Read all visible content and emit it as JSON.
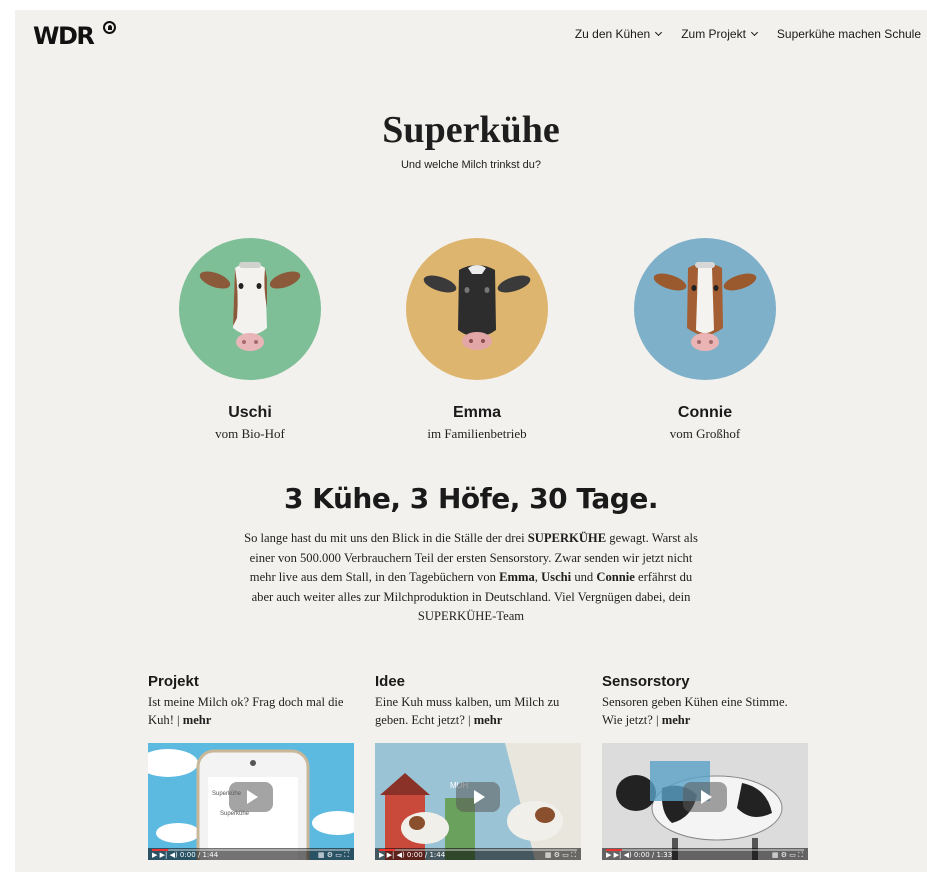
{
  "header": {
    "logo": "WDR",
    "nav": [
      {
        "label": "Zu den Kühen",
        "dropdown": true
      },
      {
        "label": "Zum Projekt",
        "dropdown": true
      },
      {
        "label": "Superkühe machen Schule",
        "dropdown": false
      }
    ]
  },
  "hero": {
    "title": "Superkühe",
    "subtitle": "Und welche Milch trinkst du?"
  },
  "cows": [
    {
      "name": "Uschi",
      "desc": "vom Bio-Hof",
      "color": "#7fbf98"
    },
    {
      "name": "Emma",
      "desc": "im Familienbetrieb",
      "color": "#ddb56f"
    },
    {
      "name": "Connie",
      "desc": "vom Großhof",
      "color": "#7fb0c9"
    }
  ],
  "intro": {
    "title": "3 Kühe, 3 Höfe, 30 Tage.",
    "p1": "So lange hast du mit uns den Blick in die Ställe der drei ",
    "b1": "SUPERKÜHE",
    "p2": " gewagt. Warst als einer von 500.000 Verbrauchern Teil der ersten Sensorstory. Zwar senden wir jetzt nicht mehr live aus dem Stall, in den Tagebüchern von ",
    "b2": "Emma",
    "p3": ", ",
    "b3": "Uschi",
    "p4": " und ",
    "b4": "Connie",
    "p5": " erfährst du aber auch weiter alles zur Milchproduktion in Deutschland. Viel Vergnügen dabei, dein SUPERKÜHE-Team"
  },
  "teasers": [
    {
      "title": "Projekt",
      "text": "Ist meine Milch ok? Frag doch mal die Kuh! | ",
      "more": "mehr",
      "time": "0:00 / 1:44"
    },
    {
      "title": "Idee",
      "text": "Eine Kuh muss kalben, um Milch zu geben. Echt jetzt? | ",
      "more": "mehr",
      "time": "0:00 / 1:44"
    },
    {
      "title": "Sensorstory",
      "text": "Sensoren geben Kühen eine Stimme. Wie jetzt? | ",
      "more": "mehr",
      "time": "0:00 / 1:33"
    }
  ],
  "video1": {
    "app_label": "Superkühe"
  },
  "video2": {
    "badge": "MUH"
  },
  "icons": {
    "dropdown": "chevron-down-icon",
    "logo_mark": "wdr-eye-icon",
    "play": "play-icon"
  }
}
